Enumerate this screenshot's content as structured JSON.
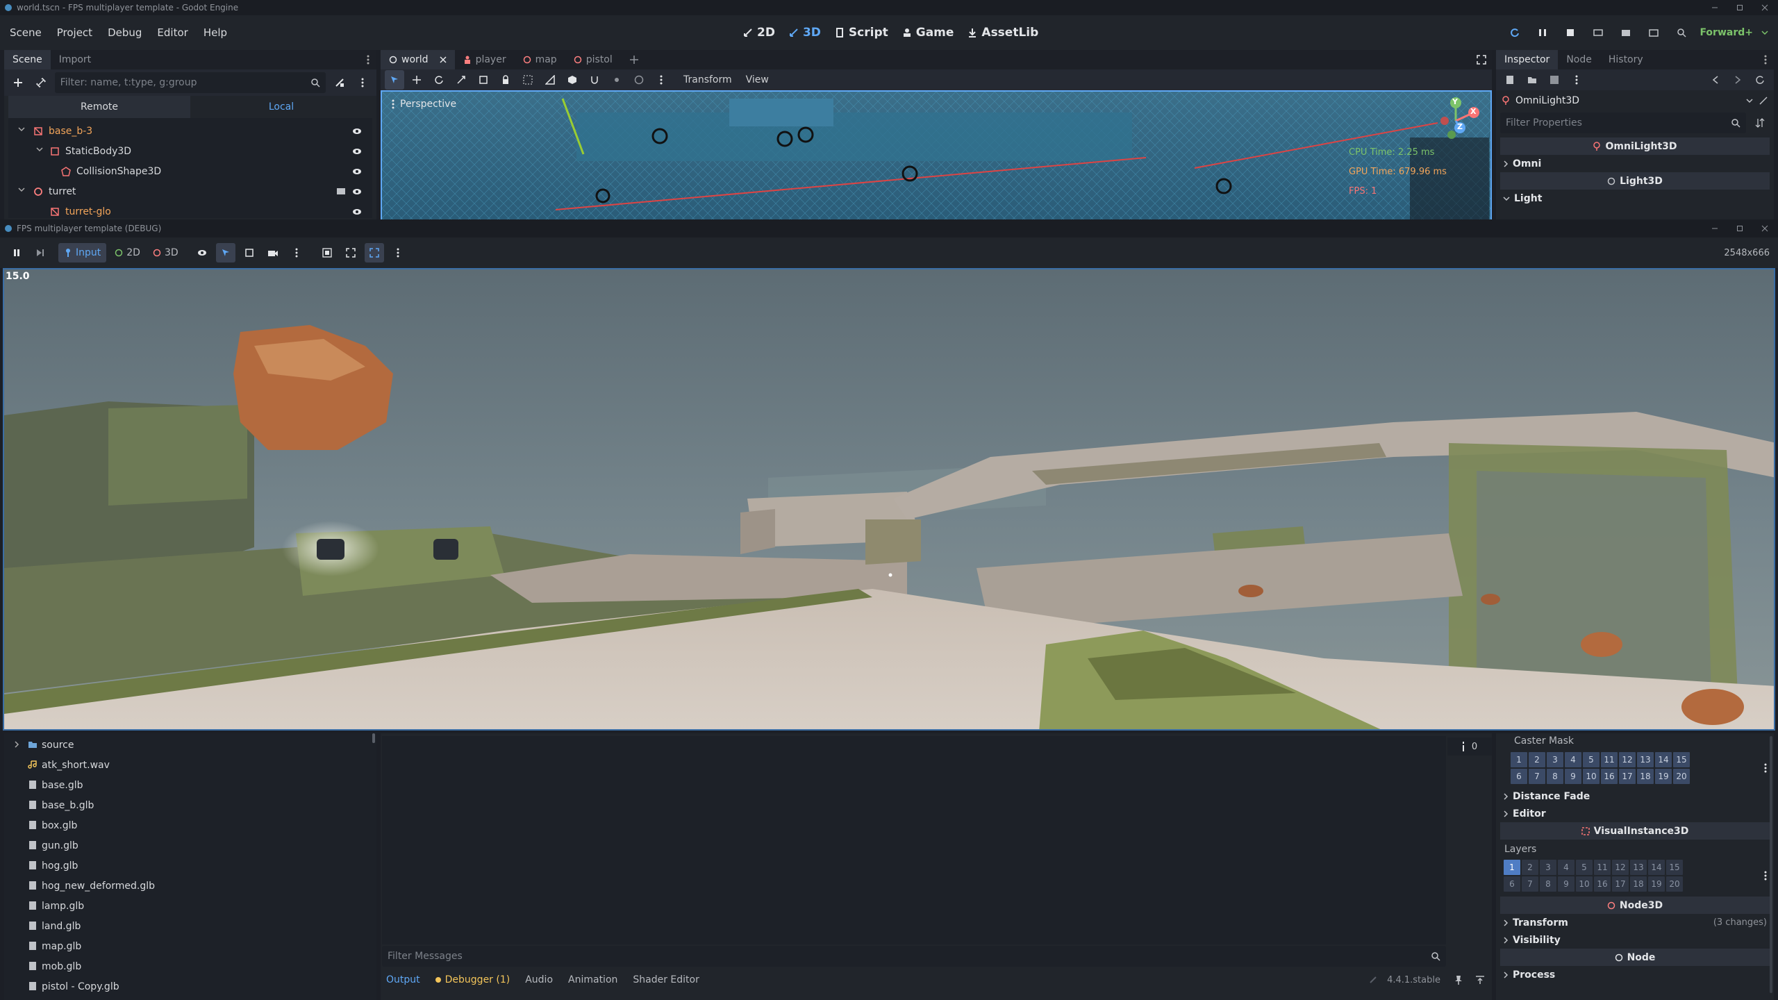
{
  "window": {
    "title": "world.tscn - FPS multiplayer template - Godot Engine",
    "game_title": "FPS multiplayer template (DEBUG)",
    "game_resolution": "2548x666"
  },
  "menu": {
    "items": [
      "Scene",
      "Project",
      "Debug",
      "Editor",
      "Help"
    ],
    "workspaces": [
      "2D",
      "3D",
      "Script",
      "Game",
      "AssetLib"
    ],
    "active_workspace": "3D",
    "renderer": "Forward+"
  },
  "scene_dock": {
    "tabs": [
      "Scene",
      "Import"
    ],
    "filter_placeholder": "Filter: name, t:type, g:group",
    "mode_tabs": [
      "Remote",
      "Local"
    ],
    "active_mode": "Local",
    "nodes": [
      {
        "name": "base_b-3",
        "type": "static",
        "indent": 0,
        "warn": true
      },
      {
        "name": "StaticBody3D",
        "type": "body",
        "indent": 1,
        "warn": false
      },
      {
        "name": "CollisionShape3D",
        "type": "shape",
        "indent": 2,
        "warn": false
      },
      {
        "name": "turret",
        "type": "node3d",
        "indent": 0,
        "warn": false
      },
      {
        "name": "turret-glo",
        "type": "static",
        "indent": 1,
        "warn": true
      }
    ]
  },
  "editor_tabs": {
    "tabs": [
      "world",
      "player",
      "map",
      "pistol"
    ],
    "active": "world"
  },
  "viewport": {
    "toolbar_menus": [
      "Transform",
      "View"
    ],
    "perspective_label": "Perspective",
    "stats": {
      "cpu": "CPU Time: 2.25 ms",
      "gpu": "GPU Time: 679.96 ms",
      "fps": "FPS: 1"
    },
    "gizmo_axes": [
      "Y",
      "X",
      "Z"
    ]
  },
  "game_toolbar": {
    "input_label": "Input",
    "mode_2d": "2D",
    "mode_3d": "3D"
  },
  "game_view": {
    "fps_counter": "15.0"
  },
  "filesystem": {
    "items": [
      {
        "name": "source",
        "kind": "folder"
      },
      {
        "name": "atk_short.wav",
        "kind": "audio"
      },
      {
        "name": "base.glb",
        "kind": "file"
      },
      {
        "name": "base_b.glb",
        "kind": "file"
      },
      {
        "name": "box.glb",
        "kind": "file"
      },
      {
        "name": "gun.glb",
        "kind": "file"
      },
      {
        "name": "hog.glb",
        "kind": "file"
      },
      {
        "name": "hog_new_deformed.glb",
        "kind": "file"
      },
      {
        "name": "lamp.glb",
        "kind": "file"
      },
      {
        "name": "land.glb",
        "kind": "file"
      },
      {
        "name": "map.glb",
        "kind": "file"
      },
      {
        "name": "mob.glb",
        "kind": "file"
      },
      {
        "name": "pistol - Copy.glb",
        "kind": "file"
      }
    ]
  },
  "inspector": {
    "tabs": [
      "Inspector",
      "Node",
      "History"
    ],
    "selected_node": "OmniLight3D",
    "filter_placeholder": "Filter Properties",
    "top_sections": [
      {
        "kind": "header",
        "label": "OmniLight3D"
      },
      {
        "kind": "section",
        "label": "Omni"
      },
      {
        "kind": "header",
        "label": "Light3D"
      },
      {
        "kind": "section",
        "label": "Light"
      }
    ],
    "caster_mask_label": "Caster Mask",
    "caster_mask_rows": [
      [
        "1",
        "2",
        "3",
        "4",
        "5",
        "11",
        "12",
        "13",
        "14",
        "15"
      ],
      [
        "6",
        "7",
        "8",
        "9",
        "10",
        "16",
        "17",
        "18",
        "19",
        "20"
      ]
    ],
    "distance_fade": "Distance Fade",
    "editor_section": "Editor",
    "visual_instance_header": "VisualInstance3D",
    "layers_label": "Layers",
    "layers_rows": [
      [
        "1",
        "2",
        "3",
        "4",
        "5",
        "11",
        "12",
        "13",
        "14",
        "15"
      ],
      [
        "6",
        "7",
        "8",
        "9",
        "10",
        "16",
        "17",
        "18",
        "19",
        "20"
      ]
    ],
    "node3d_header": "Node3D",
    "transform_label": "Transform",
    "transform_changes": "(3 changes)",
    "visibility_label": "Visibility",
    "node_header": "Node",
    "process_label": "Process"
  },
  "bottom_panel": {
    "filter_placeholder": "Filter Messages",
    "tabs": [
      "Output",
      "Debugger (1)",
      "Audio",
      "Animation",
      "Shader Editor"
    ],
    "active": "Output",
    "version": "4.4.1.stable",
    "message_count": "0"
  },
  "colors": {
    "accent": "#5fa8f5",
    "warn_node": "#f3a55a",
    "node3d_red": "#fc7f7f",
    "light_icon": "#f97575"
  }
}
